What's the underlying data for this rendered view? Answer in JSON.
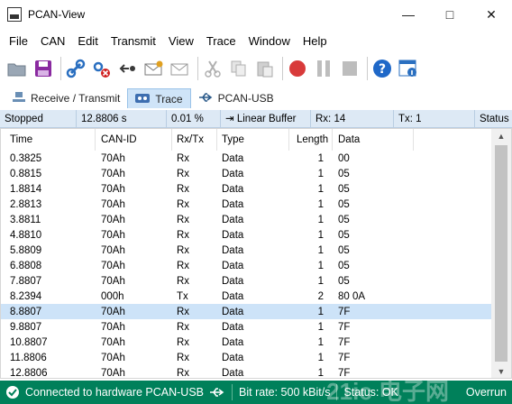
{
  "window": {
    "title": "PCAN-View"
  },
  "menu": [
    "File",
    "CAN",
    "Edit",
    "Transmit",
    "View",
    "Trace",
    "Window",
    "Help"
  ],
  "tabs": [
    {
      "label": "Receive / Transmit",
      "icon": "network-icon"
    },
    {
      "label": "Trace",
      "icon": "trace-icon"
    },
    {
      "label": "PCAN-USB",
      "icon": "usb-icon"
    }
  ],
  "trace_status": {
    "state": "Stopped",
    "time": "12.8806 s",
    "percent": "0.01 %",
    "buffer": "Linear Buffer",
    "rx": "Rx: 14",
    "tx": "Tx: 1",
    "status": "Status"
  },
  "columns": [
    "Time",
    "CAN-ID",
    "Rx/Tx",
    "Type",
    "Length",
    "Data"
  ],
  "rows": [
    [
      "0.3825",
      "70Ah",
      "Rx",
      "Data",
      "1",
      "00"
    ],
    [
      "0.8815",
      "70Ah",
      "Rx",
      "Data",
      "1",
      "05"
    ],
    [
      "1.8814",
      "70Ah",
      "Rx",
      "Data",
      "1",
      "05"
    ],
    [
      "2.8813",
      "70Ah",
      "Rx",
      "Data",
      "1",
      "05"
    ],
    [
      "3.8811",
      "70Ah",
      "Rx",
      "Data",
      "1",
      "05"
    ],
    [
      "4.8810",
      "70Ah",
      "Rx",
      "Data",
      "1",
      "05"
    ],
    [
      "5.8809",
      "70Ah",
      "Rx",
      "Data",
      "1",
      "05"
    ],
    [
      "6.8808",
      "70Ah",
      "Rx",
      "Data",
      "1",
      "05"
    ],
    [
      "7.8807",
      "70Ah",
      "Rx",
      "Data",
      "1",
      "05"
    ],
    [
      "8.2394",
      "000h",
      "Tx",
      "Data",
      "2",
      "80 0A"
    ],
    [
      "8.8807",
      "70Ah",
      "Rx",
      "Data",
      "1",
      "7F"
    ],
    [
      "9.8807",
      "70Ah",
      "Rx",
      "Data",
      "1",
      "7F"
    ],
    [
      "10.8807",
      "70Ah",
      "Rx",
      "Data",
      "1",
      "7F"
    ],
    [
      "11.8806",
      "70Ah",
      "Rx",
      "Data",
      "1",
      "7F"
    ],
    [
      "12.8806",
      "70Ah",
      "Rx",
      "Data",
      "1",
      "7F"
    ]
  ],
  "selected_row_index": 10,
  "statusbar": {
    "connection": "Connected to hardware PCAN-USB",
    "bitrate": "Bit rate: 500 kBit/s",
    "status": "Status: OK",
    "overrun": "Overrun",
    "watermark": "21ic 电子网",
    "bg_color": "#00805a"
  }
}
